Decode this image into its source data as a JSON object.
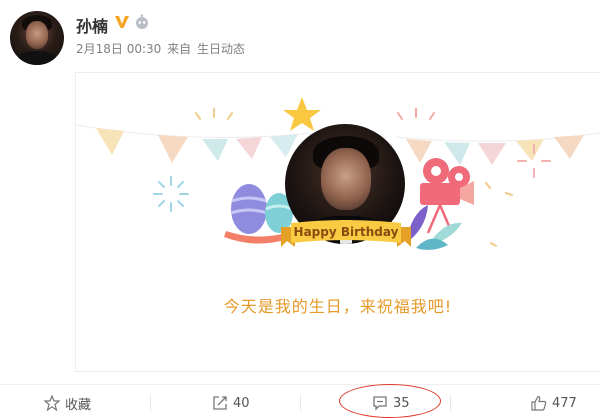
{
  "post": {
    "username": "孙楠",
    "date": "2月18日 00:30",
    "source_prefix": "来自",
    "source": "生日动态",
    "icons": [
      "verified-v-icon",
      "robot-icon"
    ]
  },
  "card": {
    "banner_text": "Happy Birthday",
    "message": "今天是我的生日，来祝福我吧!"
  },
  "actions": {
    "favorite_label": "收藏",
    "repost_count": "40",
    "comment_count": "35",
    "like_count": "477"
  },
  "colors": {
    "accent_orange": "#e79a2a",
    "verified_gold": "#f5a623",
    "annotation_red": "#e03a2a"
  }
}
